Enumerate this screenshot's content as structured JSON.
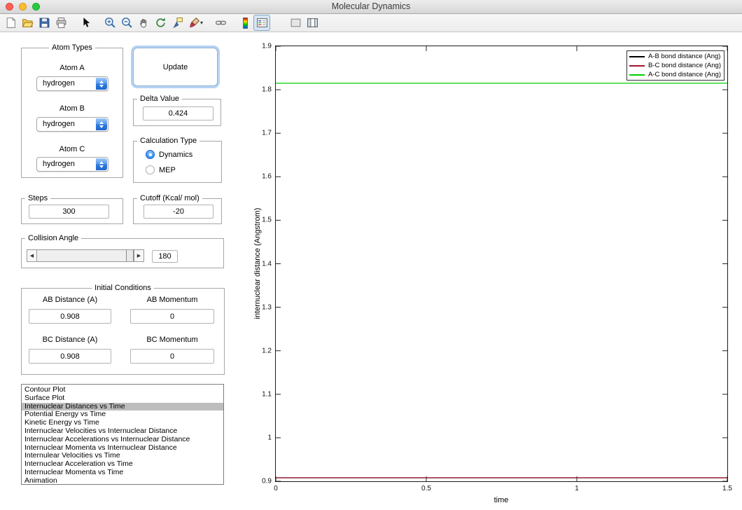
{
  "window": {
    "title": "Molecular Dynamics"
  },
  "toolbar": {
    "icons": [
      "new-figure",
      "open-file",
      "save-figure",
      "print-figure",
      "edit-plot",
      "zoom-in",
      "zoom-out",
      "pan",
      "rotate-3d",
      "data-cursor",
      "brush-data",
      "link-plot",
      "insert-colorbar",
      "insert-legend",
      "hide-plot-tools",
      "show-plot-tools"
    ],
    "active_icon": "insert-legend"
  },
  "panels": {
    "atom_types": {
      "title": "Atom Types",
      "atom_a_label": "Atom A",
      "atom_a_value": "hydrogen",
      "atom_b_label": "Atom B",
      "atom_b_value": "hydrogen",
      "atom_c_label": "Atom C",
      "atom_c_value": "hydrogen"
    },
    "update_button": "Update",
    "delta": {
      "title": "Delta Value",
      "value": "0.424"
    },
    "calculation_type": {
      "title": "Calculation Type",
      "options": [
        {
          "label": "Dynamics",
          "selected": true
        },
        {
          "label": "MEP",
          "selected": false
        }
      ]
    },
    "steps": {
      "title": "Steps",
      "value": "300"
    },
    "cutoff": {
      "title": "Cutoff (Kcal/ mol)",
      "value": "-20"
    },
    "collision_angle": {
      "title": "Collision Angle",
      "value": "180"
    },
    "initial_conditions": {
      "title": "Initial Conditions",
      "ab_distance_label": "AB Distance (A)",
      "ab_distance_value": "0.908",
      "ab_momentum_label": "AB Momentum",
      "ab_momentum_value": "0",
      "bc_distance_label": "BC Distance (A)",
      "bc_distance_value": "0.908",
      "bc_momentum_label": "BC Momentum",
      "bc_momentum_value": "0"
    }
  },
  "plot_list": {
    "items": [
      "Contour Plot",
      "Surface Plot",
      "Internuclear Distances vs Time",
      "Potential Energy vs Time",
      "Kinetic Energy vs Time",
      "Internuclear Velocities vs Internuclear Distance",
      "Internuclear Accelerations vs Internuclear Distance",
      "Internuclear Momenta vs Internuclear Distance",
      "Internulear Velocities vs Time",
      "Internuclear Acceleration vs Time",
      "Internuclear Momenta vs Time",
      "Animation"
    ],
    "selected_index": 2
  },
  "chart_data": {
    "type": "line",
    "title": "",
    "xlabel": "time",
    "ylabel": "internuclear distance (Angstrom)",
    "xlim": [
      0,
      1.5
    ],
    "ylim": [
      0.9,
      1.9
    ],
    "xticks": [
      0,
      0.5,
      1,
      1.5
    ],
    "yticks": [
      0.9,
      1,
      1.1,
      1.2,
      1.3,
      1.4,
      1.5,
      1.6,
      1.7,
      1.8,
      1.9
    ],
    "grid": false,
    "legend_position": "top-right",
    "series": [
      {
        "name": "A-B bond distance (Ang)",
        "color": "#000000",
        "x": [
          0,
          1.5
        ],
        "values": [
          0.908,
          0.908
        ]
      },
      {
        "name": "B-C bond distance (Ang)",
        "color": "#a2142f",
        "x": [
          0,
          1.5
        ],
        "values": [
          0.908,
          0.908
        ]
      },
      {
        "name": "A-C bond distance (Ang)",
        "color": "#00cf00",
        "x": [
          0,
          1.5
        ],
        "values": [
          1.815,
          1.815
        ]
      }
    ]
  }
}
